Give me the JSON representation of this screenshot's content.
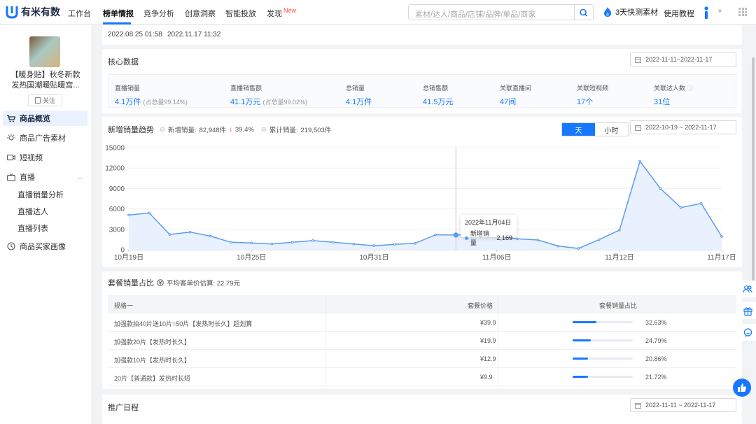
{
  "brand": {
    "name": "有米有数"
  },
  "nav": [
    {
      "label": "工作台"
    },
    {
      "label": "榜单情报"
    },
    {
      "label": "竞争分析"
    },
    {
      "label": "创意洞察"
    },
    {
      "label": "智能投放"
    },
    {
      "label": "发现",
      "badge": "New"
    }
  ],
  "search": {
    "placeholder": "素材/达人/商品/店铺/品牌/单品/商家"
  },
  "promo": {
    "label": "3天快测素材"
  },
  "tutorial": {
    "label": "使用教程"
  },
  "product": {
    "name_line1": "【暖身贴】秋冬新款",
    "name_line2": "发热国潮暖贴暖宫...",
    "follow_label": "关注"
  },
  "sidebar": {
    "items": [
      {
        "label": "商品概览",
        "icon": "cart-icon"
      },
      {
        "label": "商品广告素材",
        "icon": "bulb-icon"
      },
      {
        "label": "短视频",
        "icon": "video-icon"
      },
      {
        "label": "直播",
        "icon": "live-icon"
      }
    ],
    "live_sub": [
      "直播销量分析",
      "直播达人",
      "直播列表"
    ],
    "buyer": {
      "label": "商品买家画像",
      "icon": "clock-icon"
    }
  },
  "header_top": {
    "dates": [
      "2022.08.25 01:58",
      "2022.11.17 11:32"
    ]
  },
  "core": {
    "title": "核心数据",
    "date_range": "2022-11-11~2022-11-17",
    "metrics": [
      {
        "label": "直播销量",
        "value": "4.1万件",
        "sub": "(占总量99.14%)"
      },
      {
        "label": "直播销售额",
        "value": "41.1万元",
        "sub": "(占总量99.02%)"
      },
      {
        "label": "总销量",
        "value": "4.1万件",
        "sub": ""
      },
      {
        "label": "总销售额",
        "value": "41.5万元",
        "sub": ""
      },
      {
        "label": "关联直播间",
        "value": "47间",
        "sub": ""
      },
      {
        "label": "关联短视频",
        "value": "17个",
        "sub": ""
      },
      {
        "label": "关联达人数",
        "value": "31位",
        "sub": ""
      }
    ]
  },
  "trend": {
    "title": "新增销量趋势",
    "new_label": "新增销量:",
    "new_value": "82,948件",
    "change": "39.4%",
    "cum_label": "累计销量:",
    "cum_value": "219,503件",
    "seg_day": "天",
    "seg_hour": "小时",
    "date_range": "2022-10-19 ~ 2022-11-17",
    "tooltip_date": "2022年11月04日",
    "tooltip_label": "新增销量",
    "tooltip_value": "2,169"
  },
  "chart_data": {
    "type": "area",
    "title": "",
    "xlabel": "",
    "ylabel": "",
    "ylim": [
      0,
      15000
    ],
    "yticks": [
      "15000",
      "12000",
      "9000",
      "6000",
      "3000",
      "0"
    ],
    "x_labels": [
      "10月19日",
      "10月25日",
      "10月31日",
      "11月06日",
      "11月12日",
      "11月17日"
    ],
    "x": [
      "10-19",
      "10-20",
      "10-21",
      "10-22",
      "10-23",
      "10-24",
      "10-25",
      "10-26",
      "10-27",
      "10-28",
      "10-29",
      "10-30",
      "10-31",
      "11-01",
      "11-02",
      "11-03",
      "11-04",
      "11-05",
      "11-06",
      "11-07",
      "11-08",
      "11-09",
      "11-10",
      "11-11",
      "11-12",
      "11-13",
      "11-14",
      "11-15",
      "11-16",
      "11-17"
    ],
    "series": [
      {
        "values": [
          5100,
          5400,
          2250,
          2600,
          2000,
          1100,
          1000,
          850,
          1100,
          1350,
          1100,
          850,
          600,
          800,
          950,
          2200,
          2169,
          2250,
          2050,
          1600,
          1450,
          550,
          200,
          1500,
          2900,
          13000,
          9000,
          6200,
          6800,
          1950
        ]
      }
    ],
    "color": "#5b9bf0",
    "highlight_index": 16
  },
  "package": {
    "title": "套餐销量占比",
    "avg_label": "平均客单价估算: 22.79元",
    "headers": [
      "规格一",
      "套餐价格",
      "套餐销量占比"
    ],
    "rows": [
      {
        "name": "加强款拍40片送10片=50片【发热时长久】超划算",
        "price": "¥39.9",
        "pct": "32.63%",
        "ratio": 0.3263
      },
      {
        "name": "加强款20片【发热时长久】",
        "price": "¥19.9",
        "pct": "24.79%",
        "ratio": 0.2479
      },
      {
        "name": "加强款10片【发热时长久】",
        "price": "¥12.9",
        "pct": "20.86%",
        "ratio": 0.2086
      },
      {
        "name": "20片【普通款】发热时长短",
        "price": "¥9.9",
        "pct": "21.72%",
        "ratio": 0.2172
      }
    ]
  },
  "schedule": {
    "title": "推广日程",
    "date_range": "2022-11-11 ~ 2022-11-17"
  }
}
